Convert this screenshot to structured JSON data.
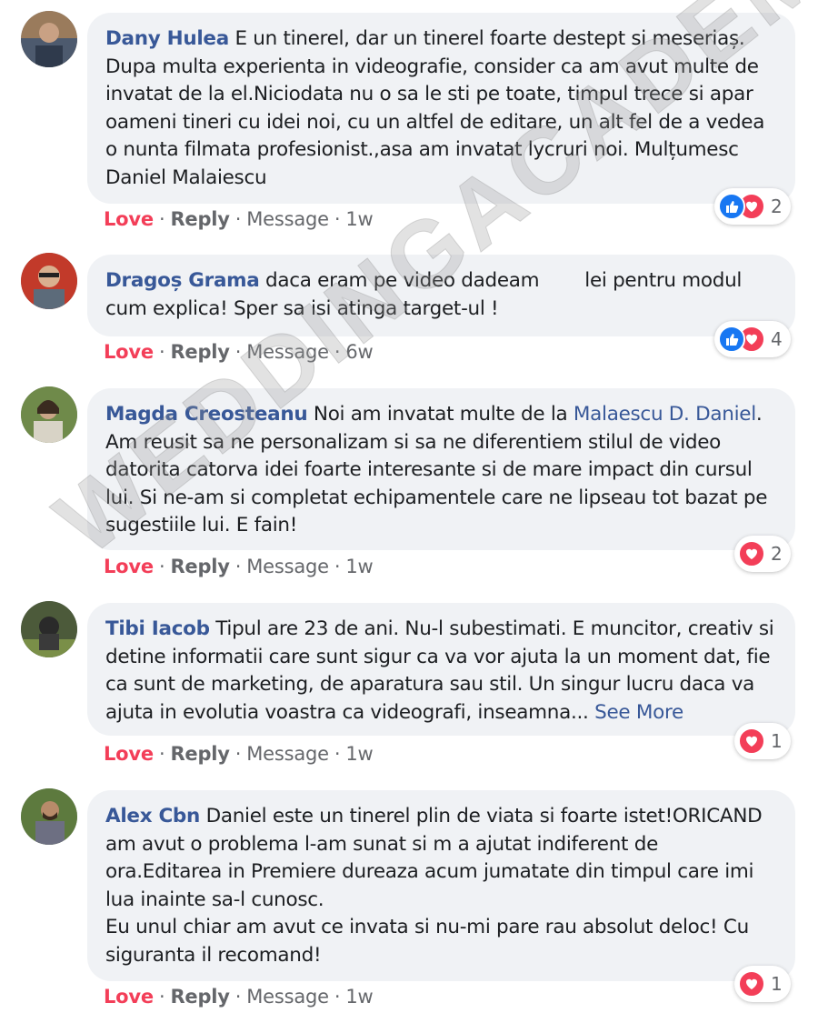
{
  "comments": [
    {
      "author": "Dany Hulea",
      "text": " E un tinerel, dar un tinerel foarte destept si meseriaș. Dupa multa experienta in videografie, consider ca am avut multe de invatat de la el.Niciodata nu o sa le sti pe toate, timpul trece si apar oameni tineri cu idei noi, cu un altfel de editare, un alt fel de a vedea o nunta filmata profesionist.,asa am invatat lycruri noi. Mulțumesc Daniel Malaiescu",
      "love": "Love",
      "reply": "Reply",
      "message": "Message",
      "time": "1w",
      "reaction_count": "2"
    },
    {
      "author": "Dragoș Grama",
      "text_a": " daca eram pe video dadeam",
      "text_b": "lei pentru modul cum explica! Sper sa isi atinga target-ul !",
      "love": "Love",
      "reply": "Reply",
      "message": "Message",
      "time": "6w",
      "reaction_count": "4"
    },
    {
      "author": "Magda Creosteanu",
      "text_a": " Noi am invatat multe de la ",
      "mention": "Malaescu D. Daniel",
      "text_b": ". Am reusit sa ne personalizam si sa ne diferentiem stilul de video datorita catorva idei foarte interesante si de mare impact din cursul lui. Si ne-am si completat echipamentele care ne lipseau tot bazat pe sugestiile lui. E fain!",
      "love": "Love",
      "reply": "Reply",
      "message": "Message",
      "time": "1w",
      "reaction_count": "2"
    },
    {
      "author": "Tibi Iacob",
      "text": " Tipul are 23 de ani. Nu-l subestimati. E muncitor, creativ si detine informatii care sunt sigur ca va vor ajuta la un moment dat, fie ca sunt de marketing, de aparatura sau stil. Un singur lucru daca va ajuta in evolutia voastra ca videografi, inseamna... ",
      "see_more": "See More",
      "love": "Love",
      "reply": "Reply",
      "message": "Message",
      "time": "1w",
      "reaction_count": "1"
    },
    {
      "author": "Alex Cbn",
      "text": " Daniel este un tinerel plin de viata si foarte istet!ORICAND am avut o problema l-am sunat si m a ajutat indiferent de ora.Editarea in Premiere dureaza acum jumatate din timpul care imi lua inainte sa-l cunosc.",
      "text_2": "Eu unul chiar am avut ce invata si nu-mi pare rau absolut deloc! Cu siguranta il recomand!",
      "love": "Love",
      "reply": "Reply",
      "message": "Message",
      "time": "1w",
      "reaction_count": "1"
    }
  ],
  "separator": "·",
  "watermark": "WEDDINGACADEMY.RO",
  "colors": {
    "author": "#385898",
    "love": "#f33e58",
    "like": "#1877f2",
    "bubble": "#f0f2f5",
    "meta": "#65676b"
  },
  "icons": [
    "like-icon",
    "love-icon"
  ]
}
